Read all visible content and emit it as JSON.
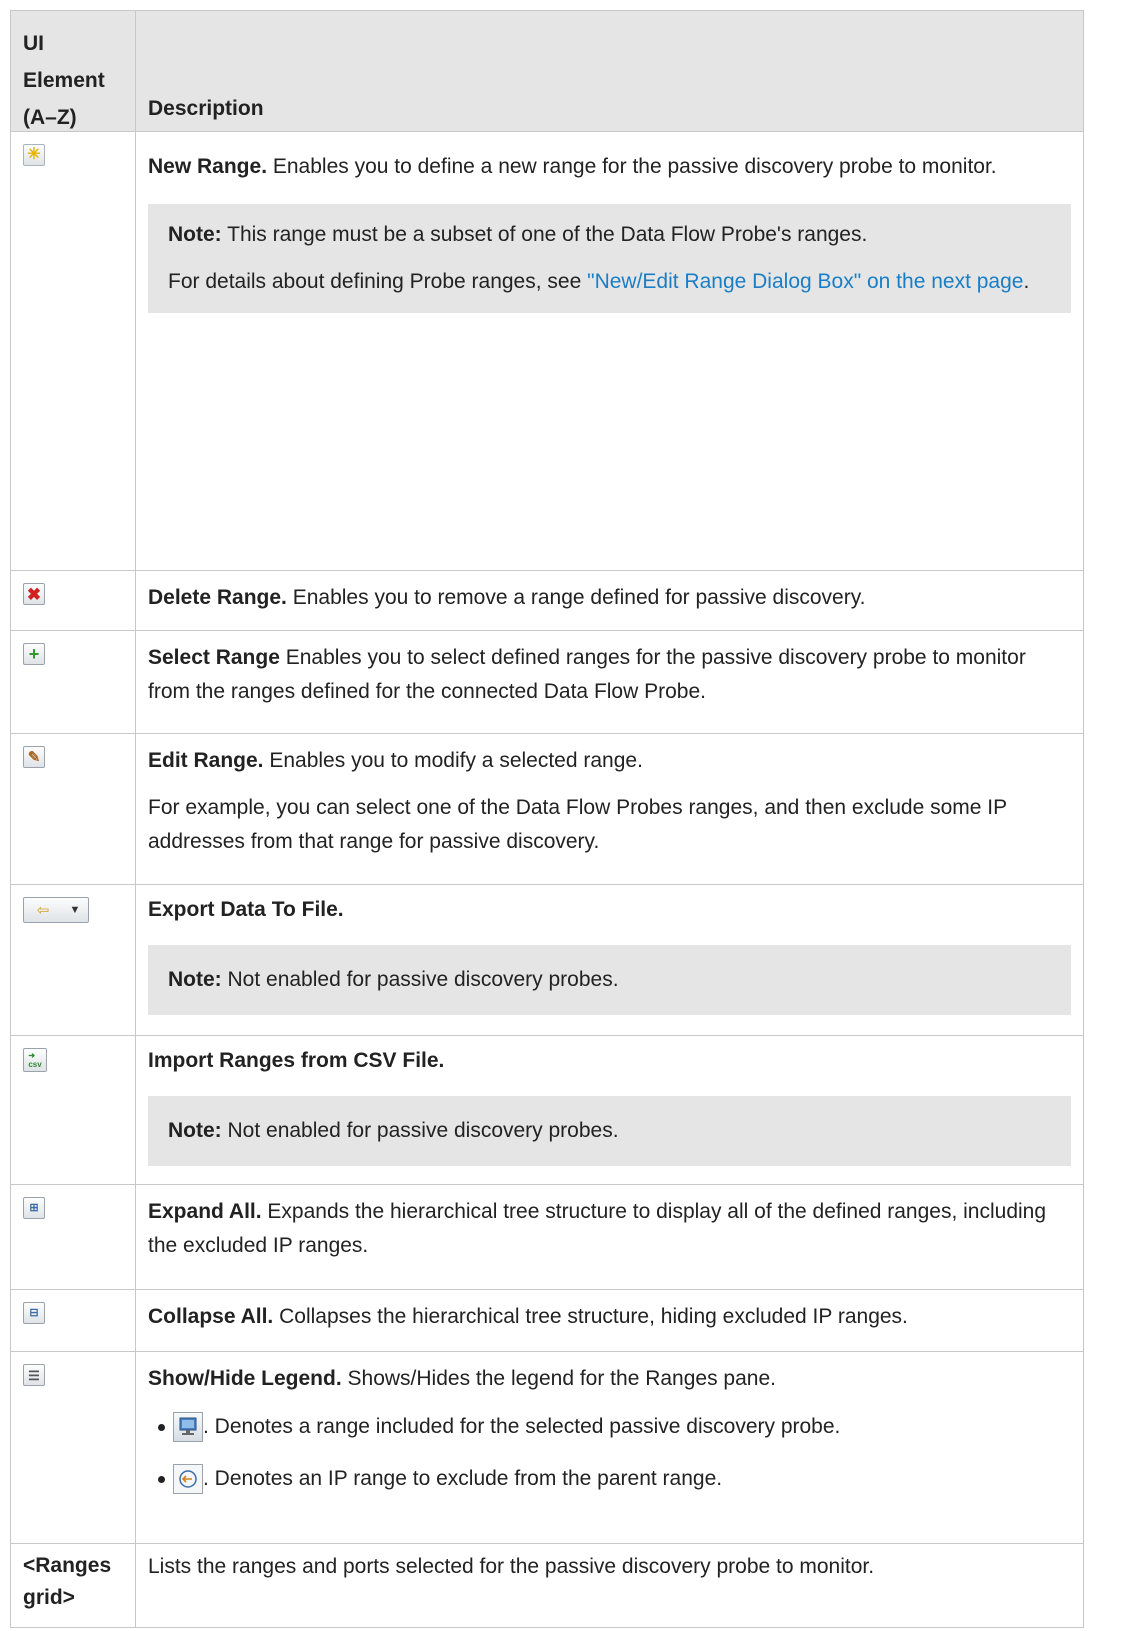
{
  "header": {
    "col1": "UI Element (A–Z)",
    "col2": "Description"
  },
  "colors": {
    "link": "#1a7ec6",
    "header_bg": "#e5e5e5",
    "note_bg": "#e5e5e5",
    "border": "#c8c8c8"
  },
  "rows": {
    "new_range": {
      "icon": "new-range-star-icon",
      "title": "New Range.",
      "text": " Enables you to define a new range for the passive discovery probe to monitor.",
      "note_label": "Note:",
      "note_text": " This range must be a subset of one of the Data Flow Probe's ranges.",
      "details_prefix": "For details about defining Probe ranges, see ",
      "details_link": "\"New/Edit Range Dialog Box\" on the next page",
      "details_suffix": "."
    },
    "delete_range": {
      "icon": "delete-x-icon",
      "title": "Delete Range.",
      "text": " Enables you to remove a range defined for passive discovery."
    },
    "select_range": {
      "icon": "add-plus-icon",
      "title": "Select Range",
      "text": " Enables you to select defined ranges for the passive discovery probe to monitor from the ranges defined for the connected Data Flow Probe."
    },
    "edit_range": {
      "icon": "pencil-icon",
      "title": "Edit Range.",
      "text": " Enables you to modify a selected range.",
      "example": "For example, you can select one of the Data Flow Probes ranges, and then exclude some IP addresses from that range for passive discovery."
    },
    "export": {
      "icon": "export-icon",
      "title": "Export Data To File.",
      "note_label": "Note:",
      "note_text": " Not enabled for passive discovery probes."
    },
    "import": {
      "icon": "import-csv-icon",
      "title": "Import Ranges from CSV File.",
      "note_label": "Note:",
      "note_text": " Not enabled for passive discovery probes."
    },
    "expand": {
      "icon": "expand-all-icon",
      "title": "Expand All.",
      "text": " Expands the hierarchical tree structure to display all of the defined ranges, including the excluded IP ranges."
    },
    "collapse": {
      "icon": "collapse-all-icon",
      "title": "Collapse All.",
      "text": " Collapses the hierarchical tree structure, hiding excluded IP ranges."
    },
    "legend": {
      "icon": "legend-icon",
      "title": "Show/Hide Legend.",
      "text": " Shows/Hides the legend for the Ranges pane.",
      "items": [
        {
          "icon": "range-included-monitor-icon",
          "text": ". Denotes a range included for the selected passive discovery probe."
        },
        {
          "icon": "ip-range-exclude-icon",
          "text": ". Denotes an IP range to exclude from the parent range."
        }
      ]
    },
    "grid": {
      "label": "<Ranges grid>",
      "text": "Lists the ranges and ports selected for the passive discovery probe to monitor."
    }
  }
}
